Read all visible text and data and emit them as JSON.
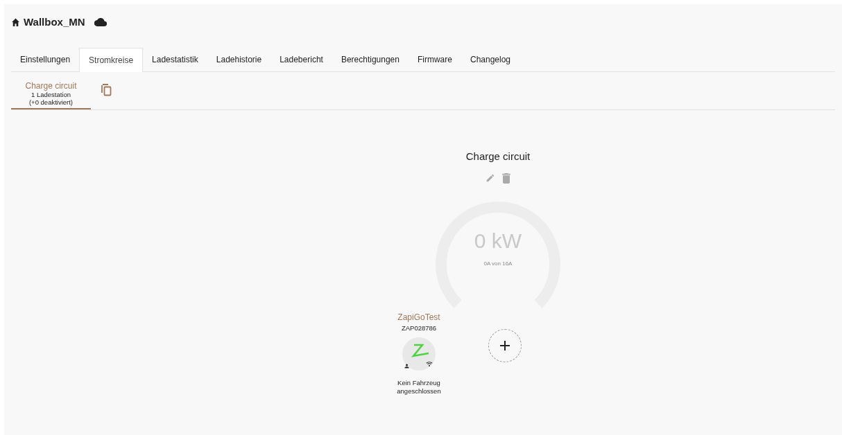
{
  "header": {
    "title": "Wallbox_MN"
  },
  "tabs": [
    {
      "label": "Einstellungen",
      "selected": false
    },
    {
      "label": "Stromkreise",
      "selected": true
    },
    {
      "label": "Ladestatistik",
      "selected": false
    },
    {
      "label": "Ladehistorie",
      "selected": false
    },
    {
      "label": "Ladebericht",
      "selected": false
    },
    {
      "label": "Berechtigungen",
      "selected": false
    },
    {
      "label": "Firmware",
      "selected": false
    },
    {
      "label": "Changelog",
      "selected": false
    }
  ],
  "circuit_tabs": [
    {
      "name": "Charge circuit",
      "stations": "1 Ladestation",
      "deactivated": "(+0 deaktiviert)",
      "selected": true
    }
  ],
  "circuit": {
    "title": "Charge circuit",
    "gauge": {
      "power": "0 kW",
      "current": "0A von 16A"
    }
  },
  "stations": [
    {
      "name": "ZapiGoTest",
      "serial": "ZAP028786",
      "status": "Kein Fahrzeug angeschlossen"
    }
  ]
}
